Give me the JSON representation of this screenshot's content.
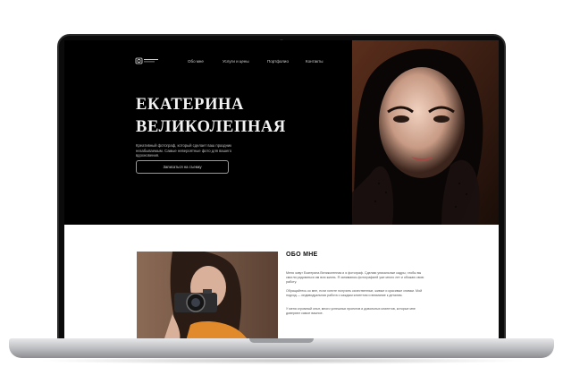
{
  "nav": {
    "items": [
      "Обо мне",
      "Услуги и цены",
      "Портфолио",
      "Контакты"
    ]
  },
  "hero": {
    "title_line1": "ЕКАТЕРИНА",
    "title_line2": "ВЕЛИКОЛЕПНАЯ",
    "subtitle": "Креативный фотограф, который сделает ваш праздник незабываемым. Самые невероятные фото для вашего вдохновения.",
    "button_label": "Записаться на съемку"
  },
  "about": {
    "title": "ОБО МНЕ",
    "paragraph1": "Меня зовут Екатерина Великолепная и я фотограф. Сделаю уникальные кадры, чтобы вы смогли радоваться им всю жизнь. Я занимаюсь фотографией уже много лет и обожаю свою работу.",
    "paragraph2": "Обращайтесь ко мне, если хотите получить качественные, живые и красивые снимки. Мой подход — индивидуальная работа с каждым клиентом и внимание к деталям.",
    "paragraph3": "У меня огромный опыт, много успешных проектов и довольных клиентов, которые мне доверяют самое важное."
  },
  "colors": {
    "hero_background": "#000000",
    "about_background": "#ffffff",
    "accent_text": "#f2f2f2"
  }
}
